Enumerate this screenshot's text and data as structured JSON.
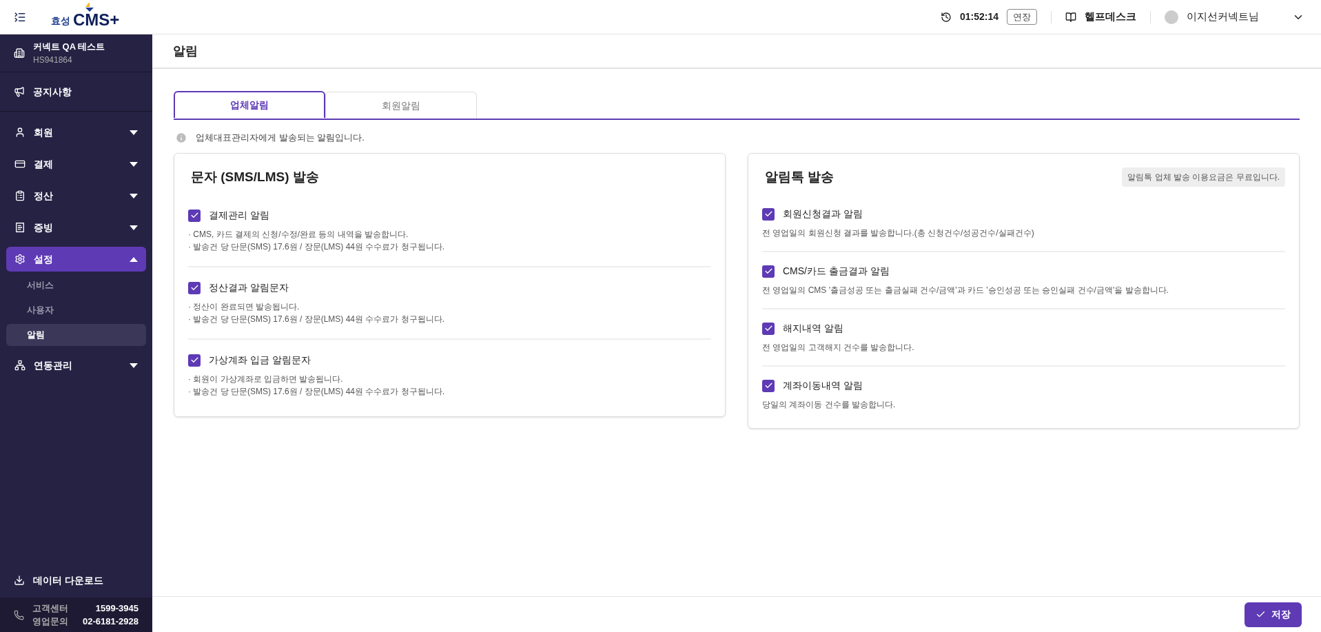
{
  "header": {
    "logo": {
      "prefix": "효성",
      "brand": "CMS+"
    },
    "session_time": "01:52:14",
    "extend_button": "연장",
    "helpdesk": "헬프데스크",
    "user_name": "이지선커넥트님"
  },
  "sidebar": {
    "company": {
      "name": "커넥트 QA 테스트",
      "code": "HS941864"
    },
    "notice": "공지사항",
    "items": [
      {
        "label": "회원",
        "expanded": false,
        "selected": false
      },
      {
        "label": "결제",
        "expanded": false,
        "selected": false
      },
      {
        "label": "정산",
        "expanded": false,
        "selected": false
      },
      {
        "label": "증빙",
        "expanded": false,
        "selected": false
      },
      {
        "label": "설정",
        "expanded": true,
        "selected": true,
        "children": [
          {
            "label": "서비스",
            "selected": false
          },
          {
            "label": "사용자",
            "selected": false
          },
          {
            "label": "알림",
            "selected": true
          }
        ]
      },
      {
        "label": "연동관리",
        "expanded": false,
        "selected": false
      }
    ],
    "download": "데이터 다운로드",
    "contacts": [
      {
        "label": "고객센터",
        "number": "1599-3945"
      },
      {
        "label": "영업문의",
        "number": "02-6181-2928"
      }
    ]
  },
  "page_title": "알림",
  "tabs": [
    {
      "label": "업체알림",
      "selected": true
    },
    {
      "label": "회원알림",
      "selected": false
    }
  ],
  "info": "업체대표관리자에게 발송되는 알림입니다.",
  "cards": [
    {
      "title": "문자 (SMS/LMS) 발송",
      "options": [
        {
          "label": "결제관리 알림",
          "checked": true,
          "notes": [
            "· CMS, 카드 결제의 신청/수정/완료 등의 내역을 발송합니다.",
            "· 발송건 당 단문(SMS) 17.6원 / 장문(LMS) 44원 수수료가 청구됩니다."
          ]
        },
        {
          "label": "정산결과 알림문자",
          "checked": true,
          "notes": [
            "· 정산이 완료되면 발송됩니다.",
            "· 발송건 당 단문(SMS) 17.6원 / 장문(LMS) 44원 수수료가 청구됩니다."
          ]
        },
        {
          "label": "가상계좌 입금 알림문자",
          "checked": true,
          "notes": [
            "· 회원이 가상계좌로 입금하면 발송됩니다.",
            "· 발송건 당 단문(SMS) 17.6원 / 장문(LMS) 44원 수수료가 청구됩니다."
          ]
        }
      ]
    },
    {
      "title": "알림톡 발송",
      "badge": "알림톡 업체 발송 이용요금은 무료입니다.",
      "options": [
        {
          "label": "회원신청결과 알림",
          "checked": true,
          "notes": [
            "전 영업일의 회원신청 결과를 발송합니다.(총 신청건수/성공건수/실패건수)"
          ]
        },
        {
          "label": "CMS/카드 출금결과 알림",
          "checked": true,
          "notes": [
            "전 영업일의 CMS '출금성공 또는 출금실패 건수/금액'과 카드 '승인성공 또는 승인실패 건수/금액'을 발송합니다."
          ]
        },
        {
          "label": "해지내역 알림",
          "checked": true,
          "notes": [
            "전 영업일의 고객해지 건수를 발송합니다."
          ]
        },
        {
          "label": "계좌이동내역 알림",
          "checked": true,
          "notes": [
            "당일의 계좌이동 건수를 발송합니다."
          ]
        }
      ]
    }
  ],
  "save_button": "저장"
}
